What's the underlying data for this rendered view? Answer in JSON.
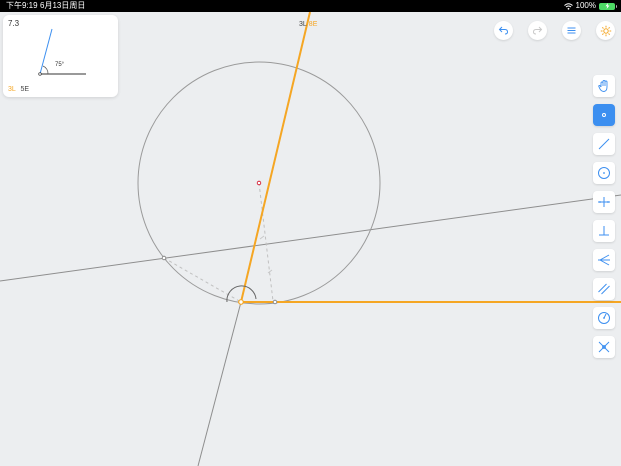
{
  "status_bar": {
    "time": "下午9:19",
    "date": "6月13日周日",
    "battery": "100%"
  },
  "level": {
    "number": "7.3",
    "angle_label": "75°",
    "goal_lines": "3L",
    "goal_euclid": "5E"
  },
  "score": {
    "lines": "3L",
    "euclid": "8E"
  },
  "colors": {
    "accent": "#f5a623",
    "tool_active": "#3c8ff0",
    "icon_blue": "#3c8ff0"
  },
  "top_buttons": [
    {
      "name": "undo-icon"
    },
    {
      "name": "redo-icon"
    },
    {
      "name": "menu-icon"
    },
    {
      "name": "hint-icon"
    }
  ],
  "tools": [
    {
      "name": "move-tool",
      "icon": "hand-icon",
      "active": false
    },
    {
      "name": "point-tool",
      "icon": "point-icon",
      "active": true
    },
    {
      "name": "line-tool",
      "icon": "line-icon",
      "active": false
    },
    {
      "name": "circle-tool",
      "icon": "circle-icon",
      "active": false
    },
    {
      "name": "perpendicular-bisector-tool",
      "icon": "perpendicular-bisector-icon",
      "active": false
    },
    {
      "name": "perpendicular-tool",
      "icon": "perpendicular-icon",
      "active": false
    },
    {
      "name": "angle-bisector-tool",
      "icon": "angle-bisector-icon",
      "active": false
    },
    {
      "name": "parallel-tool",
      "icon": "parallel-icon",
      "active": false
    },
    {
      "name": "compass-tool",
      "icon": "compass-icon",
      "active": false
    },
    {
      "name": "intersect-tool",
      "icon": "intersect-icon",
      "active": false
    }
  ]
}
